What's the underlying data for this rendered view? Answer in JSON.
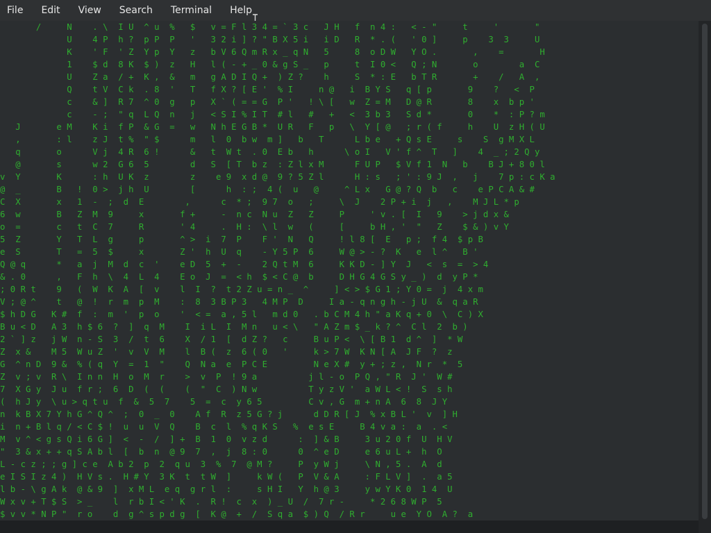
{
  "menu": [
    "File",
    "Edit",
    "View",
    "Search",
    "Terminal",
    "Help"
  ],
  "terminal": {
    "rows": [
      "       /     N    . \\  I U  ^ u  %   $   v = F l 3 4 = ` 3 c   J H   f  n 4 :   < - \"     t     '       \"",
      "             U    4 P  h ?  p P  P   '   3 2 i ] ? \" B X 5 i   i D   R  * . (   ' 0 ]     p    3  3     U",
      "             K    ' F  ' Z  Y p  Y   z   b V 6 Q m R x _ q N   5     8  o D W   Y O .       ,    =       H",
      "             1    $ d  8 K  $ )  z   H   l ( - + _ 0 & g S _   p     t  I 0 <   Q ; N       o        a  C",
      "             U    Z a  / +  K ,  &   m   g A D I Q +  ) Z ?    h     S  * : E   b T R       +    /   A  ,",
      "             Q    t V  C k  . 8  '   T   f X ? [ E '  % I     n @   i  B Y S   q [ p       9    ?   <  P",
      "             c    & ]  R 7  ^ 0  g   p   X ` ( = = G  P '   ! \\ [   w  Z = M   D @ R       8    x  b p '",
      "             c    - ;  \" q  L Q  n   j   < S I % I T  # l   #   +   <  3 b 3   S d *       0    *  : P ? m",
      "   J       e M    K i  f P  & G  =   w   N h E G B *  U R   F   p   \\  Y [ @   ; r ( f     h    U  z H ( U",
      "   ,       : l    z J  t %  \" $      m   l  0  b w  m ]   b   T      L b e   + Q s E     s    S  g M X L",
      "   q       o      V j  4 R  6 !      &   t  W t  . 0  E b   h      \\ o I   V ' f ^  T   ]    4  _ ; 2 Q y",
      "   @       s      w 2  G 6  5        d   S  [ T  b z  : Z l x M      F U P   $ V f 1  N   b    B J + 8 0 l",
      "v  Y       K      : h  U K  z        z    e 9  x d @  9 ? 5 Z l      H : s   ; ' : 9 J  ,   j    7 p : c K a",
      "@  _       B   !  0 >  j h  U        [      h  : ;  4 (  u   @     ^ L x   G @ ? Q  b   c    e P C A & #",
      "C  X       x   1  -  ;  d  E        ,      c  * ;  9 7  o   ;     \\  J    2 P + i  j   ,    M J L * p",
      "6  w       B   Z  M  9     x       f +     -  n c  N u  Z   Z     P     ' v . [  I   9    > j d x &",
      "o  =       c   t  C  7     R       ' 4     .  H :  \\ l  w   (     [     b H , '  \"   Z    $ & ) v Y",
      "5  Z       Y   T  L  g     p       ^ >  i  7  P    F '  N   Q     ! l 8 [  E   p ;  f 4  $ p B",
      "e  S       T   =  5  $     x       Z '  h  U  q    - Y 5 P  6     W @ > - ?  K   e  l ^   B '",
      "Q @ q      *   a  j  M  d  c  '    e D  5  +  -    2 Q t M  6     K K D - ] Y  J   <  s  =  > 4",
      "& . 0      ,   F  h  \\  4  L  4    E o  J  =  < h  $ < C @  b     D H G 4 G S y _ )  d  y P *",
      "; 0 R t    9   (  W  K  A  [  v    l  I  ?  t 2 Z u = n _  ^     ] < > $ G 1 ; Y 0 =  j  4 x m",
      "V ; @ ^    t   @  !  r  m  p  M    :  8  3 B P 3   4 M P  D     I a - q n g h - j U  &  q a R",
      "$ h D G   K #  f  :  m  '  p  o    '  < =  a , 5 l   m d 0   . b C M 4 h \" a K q + 0  \\  C ) X",
      "B u < D   A 3  h $ 6  ?  ]  q  M    I  i L  I  M n   u < \\   \" A Z m $ _ k ? ^  C l  2  b )",
      "2 ` ] z   j W  n - S  3  /  t  6    X  / 1  [  d Z ?   c     B u P <  \\ [ B 1  d ^  ]  * W",
      "Z  x &    M 5  W u Z  '  v  V  M    l  B (  z  6 ( 0   '     k > 7 W  K N [ A  J F  ?  z",
      "G  ^ n D  9 &  % ( q  Y  =  1  \"    Q  N a  e  P C E         N e X #  y + ; z ,  N r  *  5",
      "Z  v ; v  R \\  I n n  H  o  M  r    >  v  P  ! 9 a          j l - o  P Q , \" R  J '  W #",
      "7  X G y  J u  f r ;  6  D  (  (    (  \"  C  ) N w          T y z V '  a W L < !  S  s h",
      "(  h J y  \\ u > q t u  f  &  5  7    5  =  c  y 6 5         C v , G  m + n A  6  8  J Y",
      "n  k B X 7 Y h G ^ Q ^  ;  0  _  0    A f  R  z 5 G ? j      d D R [ J  % x B L '  v  ] H",
      "i  n + B l q / < C $ !  u  u  V  Q    B  c  l  % q K S   %  e s E     B 4 v a :  a  . <",
      "M  v ^ < g s Q i 6 G ]  <  -  /  ] +  B  1  0  v z d      :  ] & B     3 u 2 0 f  U  H V",
      "\"  3 & x + + q S A b l  [  b  n  @ 9  7  ,  j  8 : 0      0  ^ e D     e 6 u L +  h  O",
      "L - c z ; ; g ] c e  A b 2  p  2  q u  3  %  7  @ M ?     P  y W j     \\ N , 5 .  A  d",
      "e I S I z 4 )  H V s .  H # Y  3 K  t  t W  ]     k W (   P  V & A     : F L V ]  .  a 5",
      "l b - \\ g A k  @ & 9  ]  x M L  e q  g r l  :     s H I   Y  h @ 3     y w Y K 0  1 4  U",
      "W x v + T $ S  > _    l  r b I < ' K  .  R !  c  x  ) _ U  /  7 r -     * 2 6 8 W P  5",
      "$ v v * N P \"  r o    d  g ^ s p d g  [  K @  +  /  S q a  $ ) Q  / R r     u e  Y O  A ?  a"
    ]
  }
}
